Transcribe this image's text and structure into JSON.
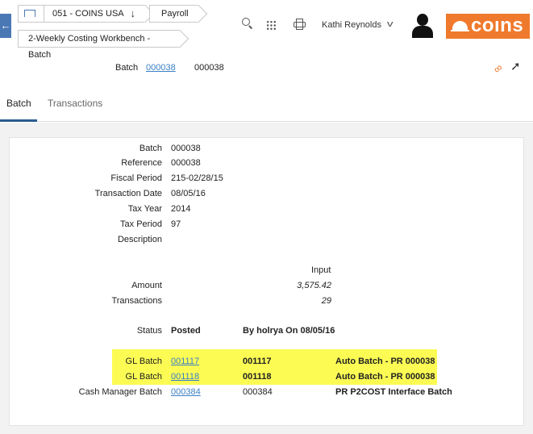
{
  "nav": {
    "company": "051 - COINS USA",
    "module": "Payroll",
    "page": "2-Weekly Costing Workbench - Batch"
  },
  "user": {
    "name": "Kathi Reynolds"
  },
  "brand": {
    "logo_text": "coıns",
    "accent_color": "#ef7a2d"
  },
  "header": {
    "label": "Batch",
    "link": "000038",
    "value": "000038"
  },
  "tabs": [
    {
      "label": "Batch",
      "active": true
    },
    {
      "label": "Transactions",
      "active": false
    }
  ],
  "details": {
    "batch_label": "Batch",
    "batch_value": "000038",
    "reference_label": "Reference",
    "reference_value": "000038",
    "fiscal_label": "Fiscal Period",
    "fiscal_value": "215-02/28/15",
    "trans_date_label": "Transaction Date",
    "trans_date_value": "08/05/16",
    "tax_year_label": "Tax Year",
    "tax_year_value": "2014",
    "tax_period_label": "Tax Period",
    "tax_period_value": "97",
    "description_label": "Description",
    "description_value": ""
  },
  "summary": {
    "input_header": "Input",
    "amount_label": "Amount",
    "amount_value": "3,575.42",
    "transactions_label": "Transactions",
    "transactions_value": "29"
  },
  "status": {
    "label": "Status",
    "value": "Posted",
    "by": "By holrya On 08/05/16"
  },
  "links": [
    {
      "label": "GL Batch",
      "link": "001117",
      "code": "001117",
      "desc": "Auto Batch - PR 000038"
    },
    {
      "label": "GL Batch",
      "link": "001118",
      "code": "001118",
      "desc": "Auto Batch - PR 000038"
    },
    {
      "label": "Cash Manager Batch",
      "link": "000384",
      "code": "000384",
      "desc": "PR P2COST Interface Batch"
    }
  ],
  "icons": [
    "back-arrow-icon",
    "home-icon",
    "chevron-down-icon",
    "search-icon",
    "apps-grid-icon",
    "print-icon",
    "user-chevron-icon",
    "avatar-icon",
    "paperclip-icon",
    "pin-icon"
  ]
}
